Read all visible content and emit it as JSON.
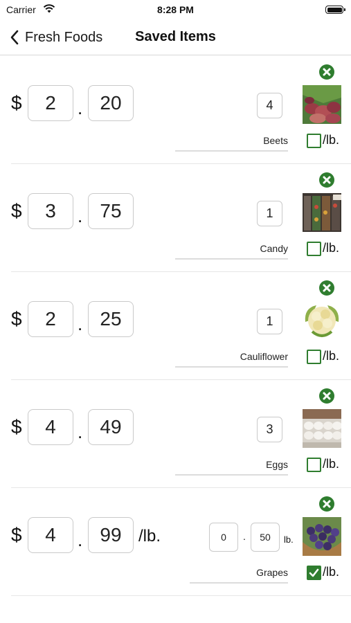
{
  "status_bar": {
    "carrier": "Carrier",
    "time": "8:28 PM"
  },
  "nav": {
    "back_label": "Fresh Foods",
    "title": "Saved Items"
  },
  "currency_symbol": "$",
  "decimal_separator": ".",
  "per_lb_label": "/lb.",
  "weight_unit_label": "lb.",
  "accent_color": "#2f7d2f",
  "items": [
    {
      "dollars": "2",
      "cents": "20",
      "quantity": "4",
      "name": "Beets",
      "per_lb_checked": false,
      "image": "beets"
    },
    {
      "dollars": "3",
      "cents": "75",
      "quantity": "1",
      "name": "Candy",
      "per_lb_checked": false,
      "image": "candy"
    },
    {
      "dollars": "2",
      "cents": "25",
      "quantity": "1",
      "name": "Cauliflower",
      "per_lb_checked": false,
      "image": "cauliflower"
    },
    {
      "dollars": "4",
      "cents": "49",
      "quantity": "3",
      "name": "Eggs",
      "per_lb_checked": false,
      "image": "eggs"
    },
    {
      "dollars": "4",
      "cents": "99",
      "weight_whole": "0",
      "weight_fraction": "50",
      "name": "Grapes",
      "per_lb_checked": true,
      "image": "grapes"
    }
  ]
}
